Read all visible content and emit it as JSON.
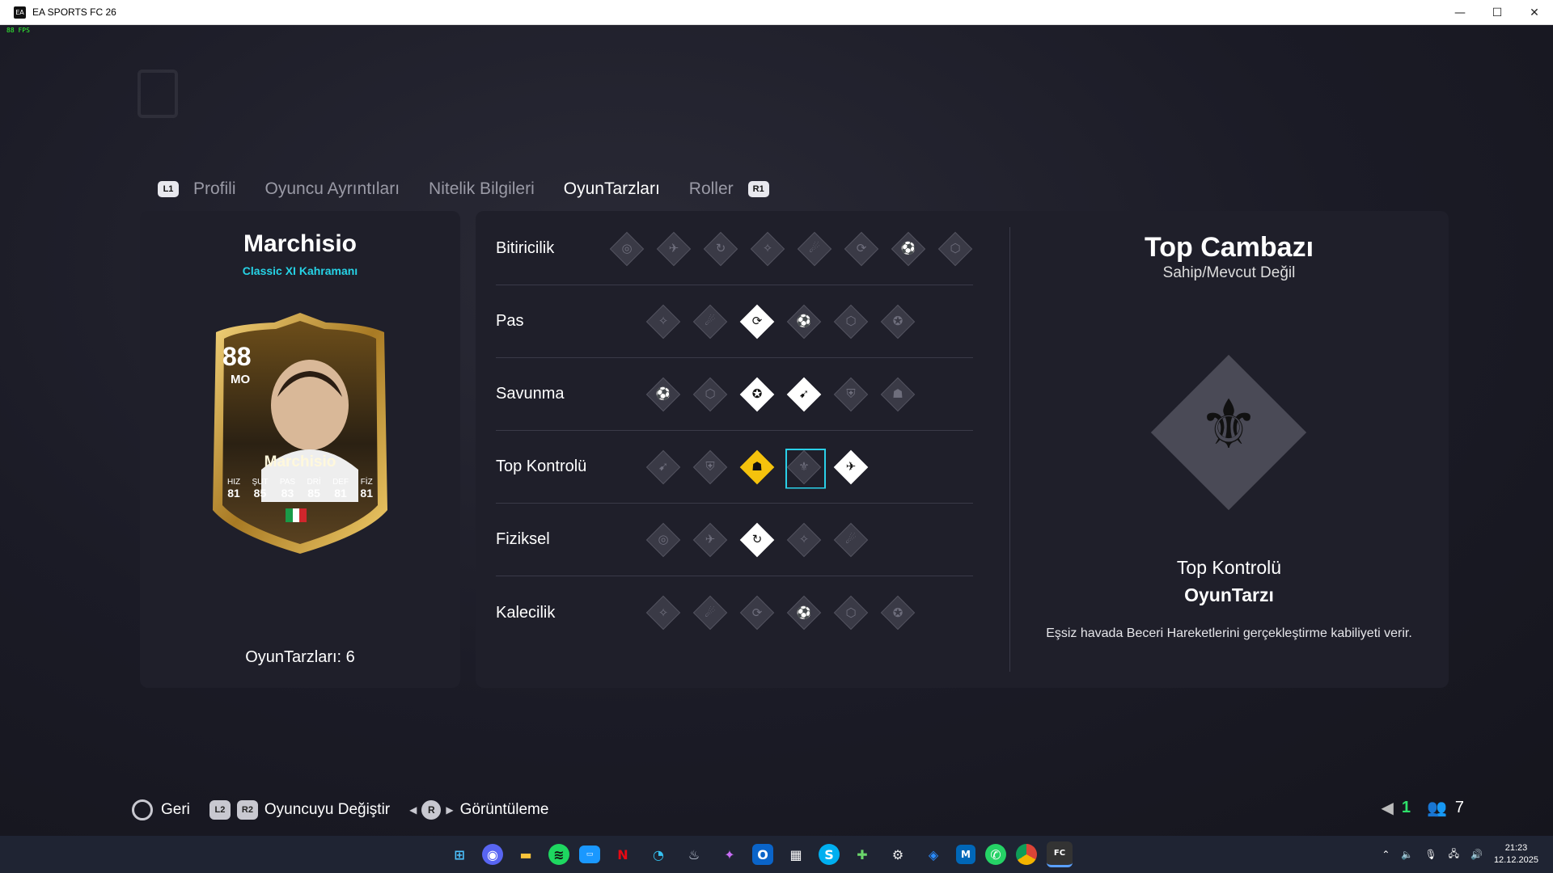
{
  "window": {
    "title": "EA SPORTS FC 26",
    "minimize": "—",
    "maximize": "☐",
    "close": "✕"
  },
  "fps": "88 FPS",
  "tabs": {
    "left_badge": "L1",
    "right_badge": "R1",
    "items": [
      {
        "label": "Profili",
        "active": false
      },
      {
        "label": "Oyuncu Ayrıntıları",
        "active": false
      },
      {
        "label": "Nitelik Bilgileri",
        "active": false
      },
      {
        "label": "OyunTarzları",
        "active": true
      },
      {
        "label": "Roller",
        "active": false
      }
    ]
  },
  "player": {
    "name": "Marchisio",
    "subtitle": "Classic XI Kahramanı",
    "card": {
      "rating": "88",
      "position": "MO",
      "name": "Marchisio",
      "stats": [
        {
          "label": "HIZ",
          "value": "81"
        },
        {
          "label": "ŞUT",
          "value": "85"
        },
        {
          "label": "PAS",
          "value": "83"
        },
        {
          "label": "DRİ",
          "value": "85"
        },
        {
          "label": "DEF",
          "value": "81"
        },
        {
          "label": "FİZ",
          "value": "81"
        }
      ]
    },
    "playstyles_count": "OyunTarzları: 6"
  },
  "categories": [
    {
      "label": "Bitiricilik",
      "icons": [
        "off",
        "off",
        "off",
        "off",
        "off",
        "off",
        "off",
        "off"
      ]
    },
    {
      "label": "Pas",
      "icons": [
        "off",
        "off",
        "on",
        "off",
        "off",
        "off"
      ]
    },
    {
      "label": "Savunma",
      "icons": [
        "off",
        "off",
        "on",
        "on",
        "off",
        "off"
      ]
    },
    {
      "label": "Top Kontrolü",
      "icons": [
        "off",
        "off",
        "plus",
        "selected",
        "on"
      ]
    },
    {
      "label": "Fiziksel",
      "icons": [
        "off",
        "off",
        "on",
        "off",
        "off"
      ]
    },
    {
      "label": "Kalecilik",
      "icons": [
        "off",
        "off",
        "off",
        "off",
        "off",
        "off"
      ]
    }
  ],
  "detail": {
    "title": "Top Cambazı",
    "status": "Sahip/Mevcut Değil",
    "category": "Top Kontrolü",
    "type": "OyunTarzı",
    "description": "Eşsiz havada Beceri Hareketlerini gerçekleştirme kabiliyeti verir."
  },
  "controls": {
    "back": "Geri",
    "l2": "L2",
    "r2": "R2",
    "change_player": "Oyuncuyu Değiştir",
    "r_button": "R",
    "view": "Görüntüleme"
  },
  "counters": {
    "left": "1",
    "right": "7"
  },
  "taskbar": {
    "time": "21:23",
    "date": "12.12.2025"
  },
  "colors": {
    "accent_cyan": "#26d3e6",
    "plus_gold": "#f4c20d",
    "counter_green": "#2ee06a"
  }
}
